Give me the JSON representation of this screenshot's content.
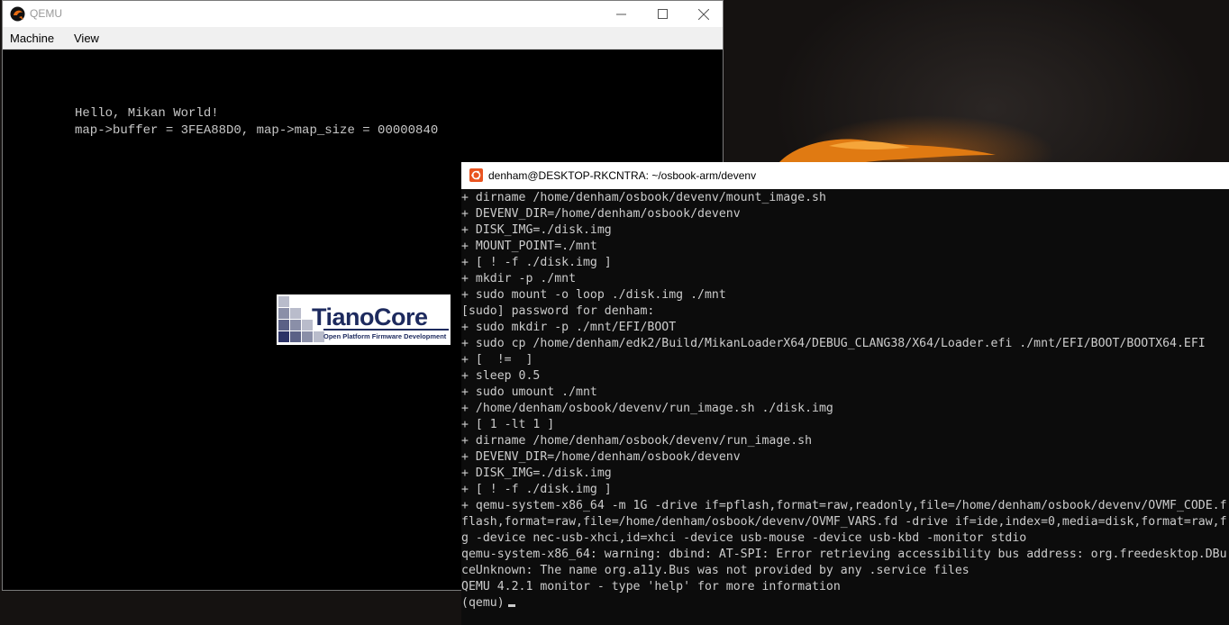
{
  "qemu": {
    "title": "QEMU",
    "menu": [
      "Machine",
      "View"
    ],
    "screen_lines": [
      "Hello, Mikan World!",
      "map->buffer = 3FEA88D0, map->map_size = 00000840"
    ],
    "logo": {
      "name_part1": "Tiano",
      "name_part2": "Core",
      "tagline": "Open Platform Firmware Development"
    }
  },
  "terminal": {
    "title": "denham@DESKTOP-RKCNTRA: ~/osbook-arm/devenv",
    "lines": [
      "+ dirname /home/denham/osbook/devenv/mount_image.sh",
      "+ DEVENV_DIR=/home/denham/osbook/devenv",
      "+ DISK_IMG=./disk.img",
      "+ MOUNT_POINT=./mnt",
      "+ [ ! -f ./disk.img ]",
      "+ mkdir -p ./mnt",
      "+ sudo mount -o loop ./disk.img ./mnt",
      "[sudo] password for denham:",
      "+ sudo mkdir -p ./mnt/EFI/BOOT",
      "+ sudo cp /home/denham/edk2/Build/MikanLoaderX64/DEBUG_CLANG38/X64/Loader.efi ./mnt/EFI/BOOT/BOOTX64.EFI",
      "+ [  !=  ]",
      "+ sleep 0.5",
      "+ sudo umount ./mnt",
      "+ /home/denham/osbook/devenv/run_image.sh ./disk.img",
      "+ [ 1 -lt 1 ]",
      "+ dirname /home/denham/osbook/devenv/run_image.sh",
      "+ DEVENV_DIR=/home/denham/osbook/devenv",
      "+ DISK_IMG=./disk.img",
      "+ [ ! -f ./disk.img ]",
      "+ qemu-system-x86_64 -m 1G -drive if=pflash,format=raw,readonly,file=/home/denham/osbook/devenv/OVMF_CODE.f",
      "flash,format=raw,file=/home/denham/osbook/devenv/OVMF_VARS.fd -drive if=ide,index=0,media=disk,format=raw,f",
      "g -device nec-usb-xhci,id=xhci -device usb-mouse -device usb-kbd -monitor stdio",
      "qemu-system-x86_64: warning: dbind: AT-SPI: Error retrieving accessibility bus address: org.freedesktop.DBu",
      "ceUnknown: The name org.a11y.Bus was not provided by any .service files",
      "QEMU 4.2.1 monitor - type 'help' for more information"
    ],
    "prompt": "(qemu)"
  }
}
